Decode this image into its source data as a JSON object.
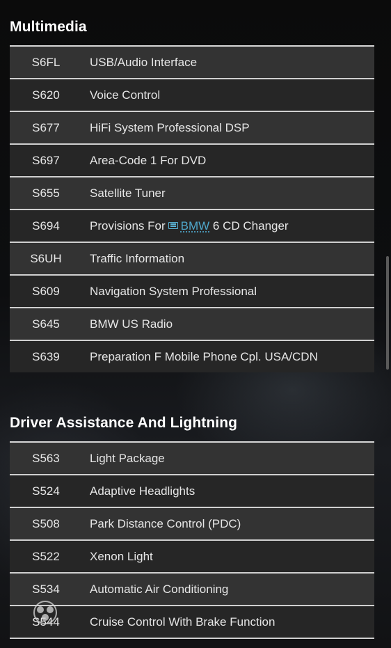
{
  "sections": [
    {
      "title": "Multimedia",
      "rows": [
        {
          "code": "S6FL",
          "desc": "USB/Audio Interface"
        },
        {
          "code": "S620",
          "desc": "Voice Control"
        },
        {
          "code": "S677",
          "desc": "HiFi System Professional DSP"
        },
        {
          "code": "S697",
          "desc": "Area-Code 1 For DVD"
        },
        {
          "code": "S655",
          "desc": "Satellite Tuner"
        },
        {
          "code": "S694",
          "desc_prefix": "Provisions For",
          "link_text": "BMW",
          "desc_suffix": "6 CD Changer"
        },
        {
          "code": "S6UH",
          "desc": "Traffic Information"
        },
        {
          "code": "S609",
          "desc": "Navigation System Professional"
        },
        {
          "code": "S645",
          "desc": "BMW US Radio"
        },
        {
          "code": "S639",
          "desc": "Preparation F Mobile Phone Cpl. USA/CDN"
        }
      ]
    },
    {
      "title": "Driver Assistance And Lightning",
      "rows": [
        {
          "code": "S563",
          "desc": "Light Package"
        },
        {
          "code": "S524",
          "desc": "Adaptive Headlights"
        },
        {
          "code": "S508",
          "desc": "Park Distance Control (PDC)"
        },
        {
          "code": "S522",
          "desc": "Xenon Light"
        },
        {
          "code": "S534",
          "desc": "Automatic Air Conditioning"
        },
        {
          "code": "S544",
          "desc": "Cruise Control With Brake Function"
        }
      ]
    }
  ],
  "icons": {
    "inline_link_icon": "article-link-icon",
    "watermark_icon": "site-logo-icon"
  },
  "colors": {
    "row_light": "#333333",
    "row_dark": "#262626",
    "divider": "#d0d0d0",
    "link": "#4fa8cc"
  }
}
